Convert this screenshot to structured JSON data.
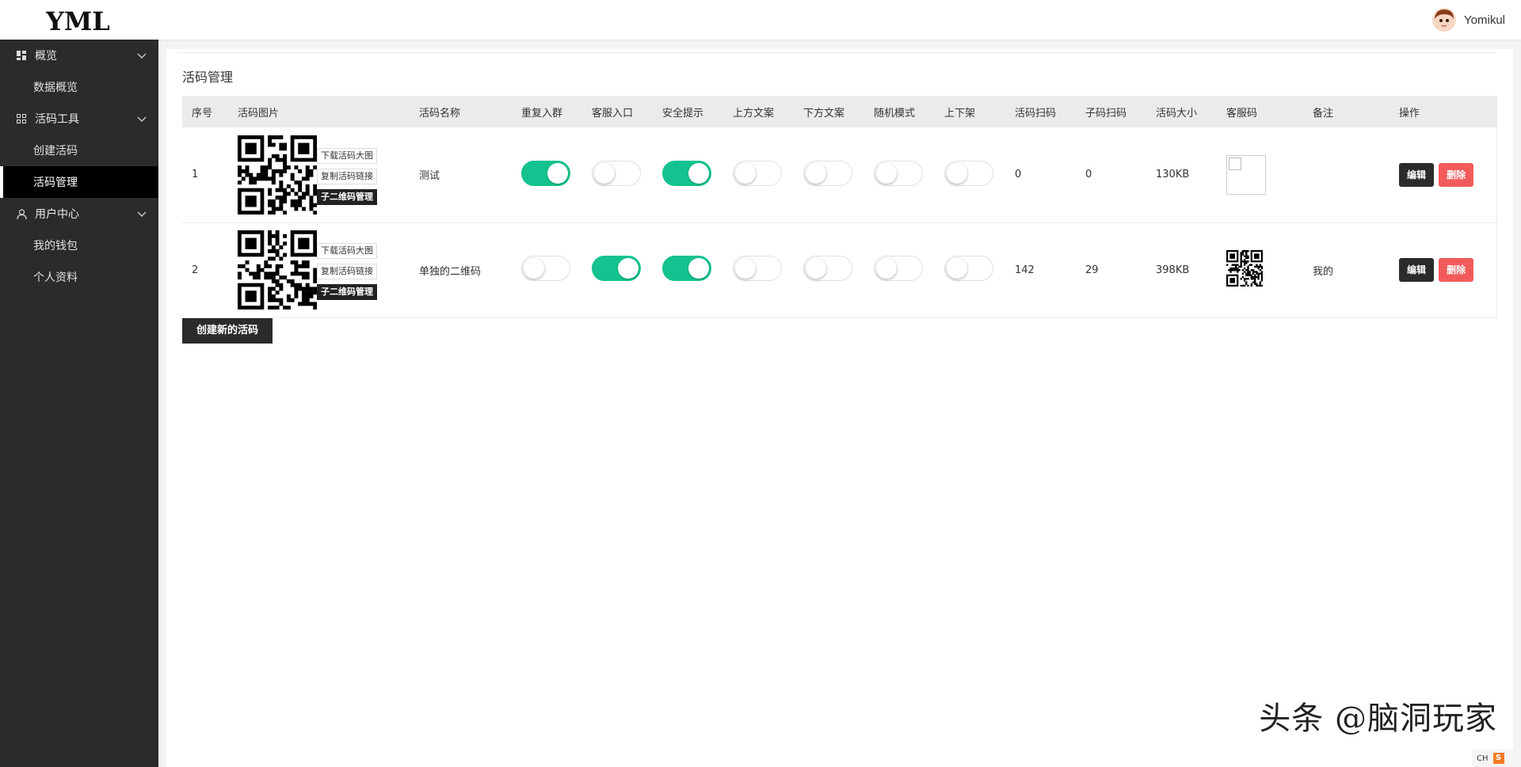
{
  "header": {
    "logo_text": "YML",
    "user_name": "Yomikul"
  },
  "sidebar": {
    "groups": [
      {
        "label": "概览",
        "icon": "dashboard-icon",
        "items": [
          {
            "label": "数据概览"
          }
        ]
      },
      {
        "label": "活码工具",
        "icon": "grid-icon",
        "items": [
          {
            "label": "创建活码"
          },
          {
            "label": "活码管理",
            "active": true
          }
        ]
      },
      {
        "label": "用户中心",
        "icon": "user-icon",
        "items": [
          {
            "label": "我的钱包"
          },
          {
            "label": "个人资料"
          }
        ]
      }
    ]
  },
  "main": {
    "title": "活码管理",
    "columns": [
      "序号",
      "活码图片",
      "活码名称",
      "重复入群",
      "客服入口",
      "安全提示",
      "上方文案",
      "下方文案",
      "随机模式",
      "上下架",
      "活码扫码",
      "子码扫码",
      "活码大小",
      "客服码",
      "备注",
      "操作"
    ],
    "qr_actions": {
      "download": "下载活码大图",
      "copy_link": "复制活码链接",
      "sub_manage": "子二维码管理"
    },
    "rows": [
      {
        "index": "1",
        "name": "测试",
        "switches": [
          true,
          false,
          true,
          false,
          false,
          false,
          false
        ],
        "scans": "0",
        "sub_scans": "0",
        "size": "130KB",
        "service_qr": "empty",
        "note": ""
      },
      {
        "index": "2",
        "name": "单独的二维码",
        "switches": [
          false,
          true,
          true,
          false,
          false,
          false,
          false
        ],
        "scans": "142",
        "sub_scans": "29",
        "size": "398KB",
        "service_qr": "qr",
        "note": "我的"
      }
    ],
    "edit_label": "编辑",
    "delete_label": "删除",
    "create_label": "创建新的活码"
  },
  "watermark": "头条 @脑洞玩家",
  "ime": {
    "label": "CH",
    "icon_text": "S"
  },
  "colors": {
    "switch_on": "#13c28f",
    "sidebar_bg": "#2b2b2b",
    "delete_btn": "#f25b5b"
  }
}
